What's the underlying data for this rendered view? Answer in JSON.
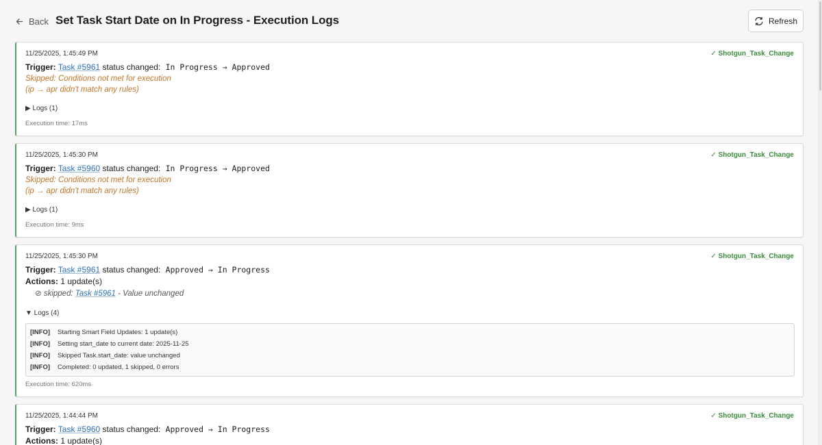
{
  "header": {
    "back_label": "Back",
    "title": "Set Task Start Date on In Progress - Execution Logs",
    "refresh_label": "Refresh"
  },
  "cards": [
    {
      "timestamp": "11/25/2025, 1:45:49 PM",
      "source": "✓ Shotgun_Task_Change",
      "trigger_label": "Trigger:",
      "task": "Task #5961",
      "status_text": "status changed:",
      "transition": "In Progress → Approved",
      "skipped_line1": "Skipped: Conditions not met for execution",
      "skipped_line2": "(ip → apr didn't match any rules)",
      "logs_label": "▶ Logs (1)",
      "exec_time": "Execution time: 17ms"
    },
    {
      "timestamp": "11/25/2025, 1:45:30 PM",
      "source": "✓ Shotgun_Task_Change",
      "trigger_label": "Trigger:",
      "task": "Task #5960",
      "status_text": "status changed:",
      "transition": "In Progress → Approved",
      "skipped_line1": "Skipped: Conditions not met for execution",
      "skipped_line2": "(ip → apr didn't match any rules)",
      "logs_label": "▶ Logs (1)",
      "exec_time": "Execution time: 9ms"
    },
    {
      "timestamp": "11/25/2025, 1:45:30 PM",
      "source": "✓ Shotgun_Task_Change",
      "trigger_label": "Trigger:",
      "task": "Task #5961",
      "status_text": "status changed:",
      "transition": "Approved → In Progress",
      "actions_label": "Actions:",
      "actions_value": "1 update(s)",
      "action_prefix": "⊘ skipped:",
      "action_task": "Task #5961",
      "action_suffix": "- Value unchanged",
      "logs_label": "▼ Logs (4)",
      "logs": [
        {
          "level": "[INFO]",
          "message": "Starting Smart Field Updates: 1 update(s)"
        },
        {
          "level": "[INFO]",
          "message": "Setting start_date to current date: 2025-11-25"
        },
        {
          "level": "[INFO]",
          "message": "Skipped Task.start_date: value unchanged"
        },
        {
          "level": "[INFO]",
          "message": "Completed: 0 updated, 1 skipped, 0 errors"
        }
      ],
      "exec_time": "Execution time: 620ms"
    },
    {
      "timestamp": "11/25/2025, 1:44:44 PM",
      "source": "✓ Shotgun_Task_Change",
      "trigger_label": "Trigger:",
      "task": "Task #5960",
      "status_text": "status changed:",
      "transition": "Approved → In Progress",
      "actions_label": "Actions:",
      "actions_value": "1 update(s)"
    }
  ],
  "colors": {
    "accent_border": "#59a25a",
    "source_green": "#3a8a3b",
    "skipped_orange": "#c0762b",
    "link_blue": "#2b6fb8"
  },
  "icons": {
    "back": "arrow-left-icon",
    "refresh": "refresh-icon"
  }
}
